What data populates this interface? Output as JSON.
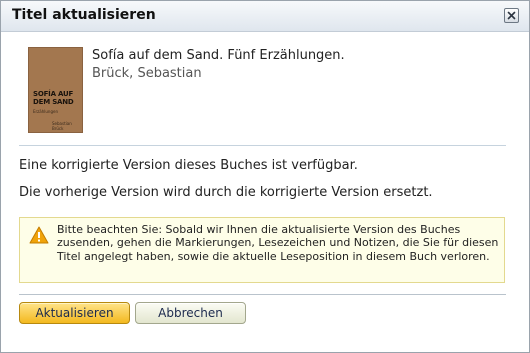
{
  "dialog": {
    "title": "Titel aktualisieren"
  },
  "book": {
    "title": "Sofía auf dem Sand. Fünf Erzählungen.",
    "author": "Brück, Sebastian",
    "cover": {
      "title": "SOFÍA AUF DEM SAND",
      "subtitle": "Erzählungen",
      "author": "Sebastian Brück",
      "color": "#a3774f"
    }
  },
  "messages": {
    "available": "Eine korrigierte Version dieses Buches ist verfügbar.",
    "replace": "Die vorherige Version wird durch die korrigierte Version ersetzt."
  },
  "warning": {
    "icon": "warning-icon",
    "text": "Bitte beachten Sie: Sobald wir Ihnen die aktualisierte Version des Buches zusenden, gehen die Markierungen, Lesezeichen und Notizen, die Sie für diesen Titel angelegt haben, sowie die aktuelle Leseposition in diesem Buch verloren."
  },
  "buttons": {
    "update": "Aktualisieren",
    "cancel": "Abbrechen"
  },
  "colors": {
    "primary_button": "#f3b91f",
    "warning_background": "#fefee8",
    "warning_icon": "#f0a30a"
  }
}
